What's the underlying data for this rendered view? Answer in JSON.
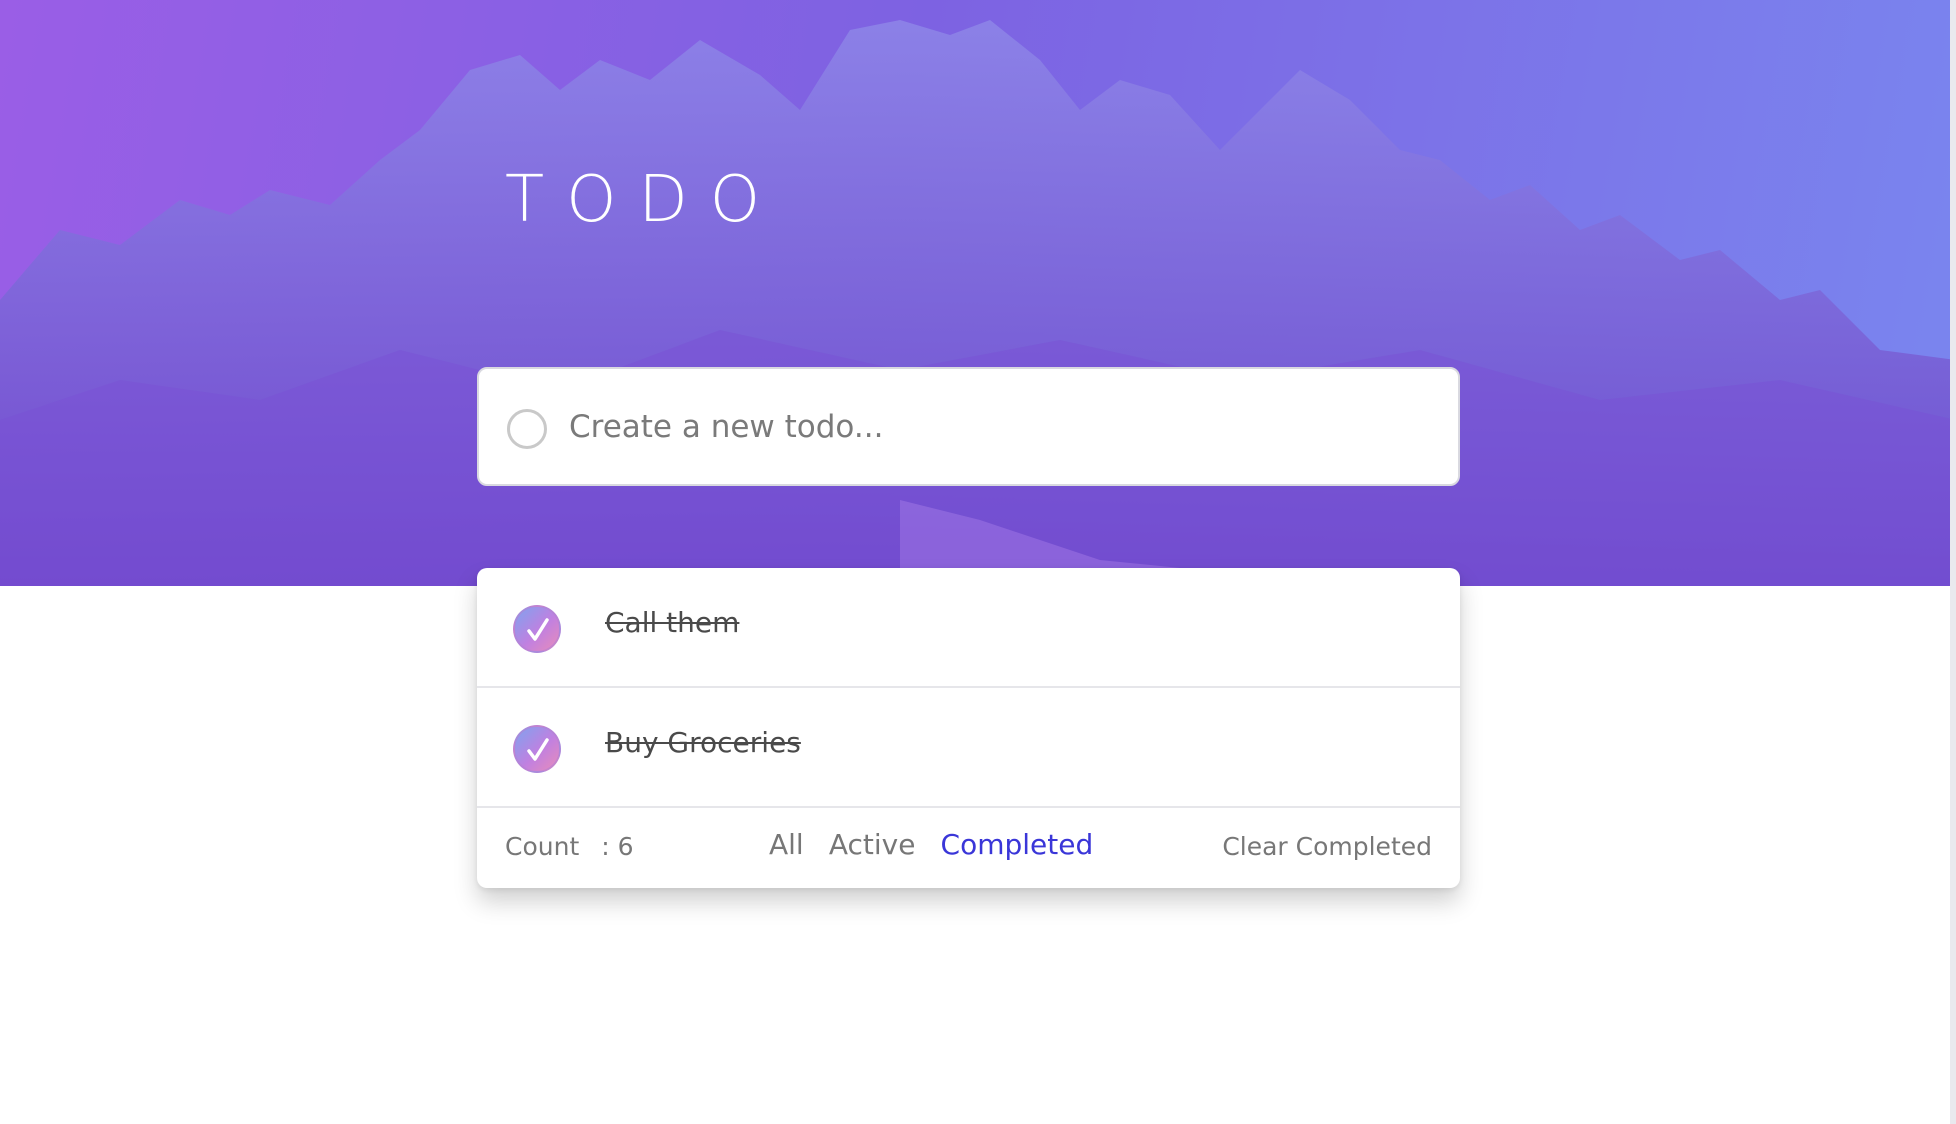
{
  "app": {
    "title": "TODO"
  },
  "new_todo": {
    "placeholder": "Create a new todo..."
  },
  "todos": [
    {
      "text": "Call them",
      "completed": true
    },
    {
      "text": "Buy Groceries",
      "completed": true
    }
  ],
  "footer": {
    "count_label": "Count",
    "count_value": ": 6",
    "filters": [
      "All",
      "Active",
      "Completed"
    ],
    "active_filter": "Completed",
    "clear_label": "Clear Completed"
  },
  "colors": {
    "hero_start": "#9a5ee6",
    "hero_end": "#7a86ef",
    "active_filter": "#3a36d8",
    "check_gradient_start": "#7fa3ef",
    "check_gradient_end": "#e98cba"
  },
  "icons": {
    "new_todo_circle": "circle-outline-icon",
    "check": "checkmark-icon",
    "background": "mountain-image"
  }
}
